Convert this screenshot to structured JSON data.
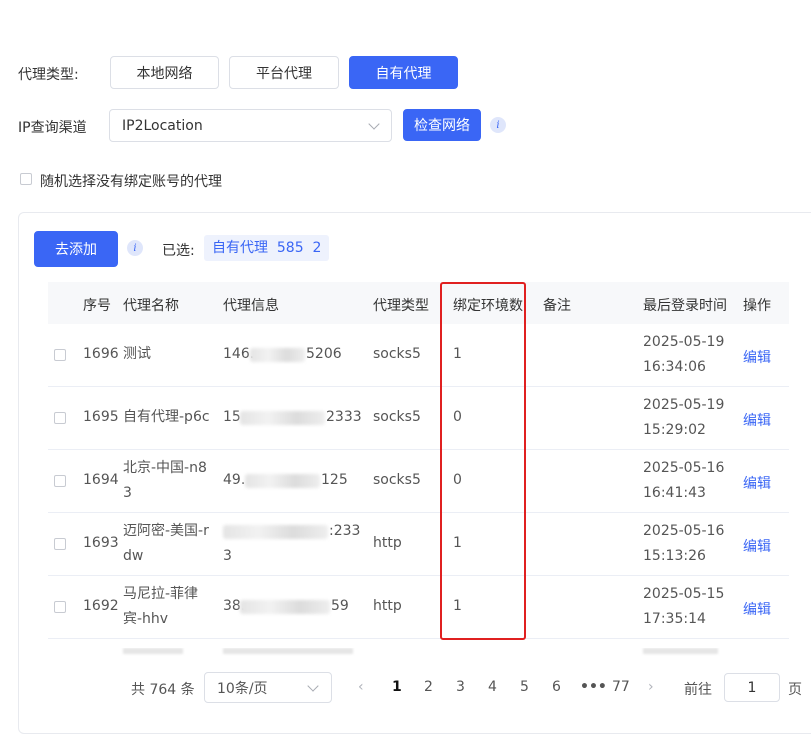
{
  "proxy_type": {
    "label": "代理类型:",
    "options": [
      "本地网络",
      "平台代理",
      "自有代理"
    ],
    "selected": "自有代理"
  },
  "ip_channel": {
    "label": "IP查询渠道",
    "value": "IP2Location",
    "check_button": "检查网络"
  },
  "random_checkbox_label": "随机选择没有绑定账号的代理",
  "add_button": "去添加",
  "selected_label": "已选:",
  "selected_tag": "自有代理  585  2",
  "table": {
    "headers": [
      "序号",
      "代理名称",
      "代理信息",
      "代理类型",
      "绑定环境数",
      "备注",
      "最后登录时间",
      "操作"
    ],
    "rows": [
      {
        "id": "1696",
        "name": [
          "测试"
        ],
        "info": [
          "146.",
          "5206"
        ],
        "type": "socks5",
        "bound": "1",
        "note": "",
        "date": "2025-05-19",
        "time": "16:34:06",
        "action": "编辑"
      },
      {
        "id": "1695",
        "name": [
          "自有代理-p6c"
        ],
        "info": [
          "15",
          "2333"
        ],
        "type": "socks5",
        "bound": "0",
        "note": "",
        "date": "2025-05-19",
        "time": "15:29:02",
        "action": "编辑"
      },
      {
        "id": "1694",
        "name": [
          "北京-中国-n8",
          "3"
        ],
        "info": [
          "49.",
          "125"
        ],
        "type": "socks5",
        "bound": "0",
        "note": "",
        "date": "2025-05-16",
        "time": "16:41:43",
        "action": "编辑"
      },
      {
        "id": "1693",
        "name": [
          "迈阿密-美国-r",
          "dw"
        ],
        "info": [
          ":233",
          "3"
        ],
        "type": "http",
        "bound": "1",
        "note": "",
        "date": "2025-05-16",
        "time": "15:13:26",
        "action": "编辑"
      },
      {
        "id": "1692",
        "name": [
          "马尼拉-菲律",
          "宾-hhv"
        ],
        "info": [
          "38.",
          "59"
        ],
        "type": "http",
        "bound": "1",
        "note": "",
        "date": "2025-05-15",
        "time": "17:35:14",
        "action": "编辑"
      }
    ]
  },
  "pagination": {
    "total": "共 764 条",
    "page_size": "10条/页",
    "pages": [
      "1",
      "2",
      "3",
      "4",
      "5",
      "6",
      "•••",
      "77"
    ],
    "current": "1",
    "goto_label": "前往",
    "goto_value": "1",
    "page_unit": "页"
  },
  "colors": {
    "primary": "#3a66f5",
    "highlight_box": "#e02020"
  }
}
